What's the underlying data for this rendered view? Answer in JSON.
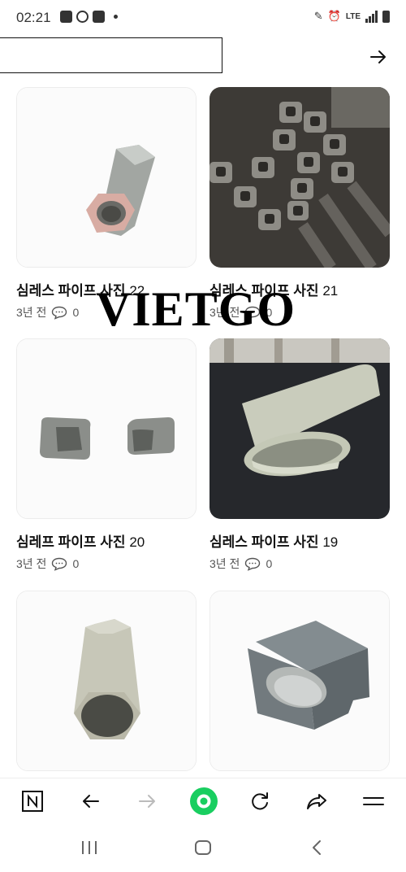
{
  "status": {
    "time": "02:21",
    "network": "LTE"
  },
  "search": {
    "placeholder": ""
  },
  "watermark": "VIETGO",
  "cards": [
    {
      "title": "심레스 파이프 사진",
      "num": "22",
      "time": "3년 전",
      "comments": "0"
    },
    {
      "title": "심레스 파이프 사진",
      "num": "21",
      "time": "3년 전",
      "comments": "0"
    },
    {
      "title": "심레프 파이프 사진",
      "num": "20",
      "time": "3년 전",
      "comments": "0"
    },
    {
      "title": "심레스 파이프 사진",
      "num": "19",
      "time": "3년 전",
      "comments": "0"
    }
  ],
  "colors": {
    "accent": "#19ce60",
    "text": "#111111",
    "muted": "#555555"
  },
  "icons": [
    "image-icon",
    "whatsapp-icon",
    "app-icon",
    "pencil-icon",
    "alarm-icon",
    "signal-icon",
    "battery-icon",
    "arrow-right-icon",
    "comment-icon",
    "naver-icon",
    "back-icon",
    "forward-icon",
    "green-dot-icon",
    "refresh-icon",
    "share-icon",
    "menu-icon",
    "recent-apps-icon",
    "home-icon",
    "system-back-icon"
  ]
}
